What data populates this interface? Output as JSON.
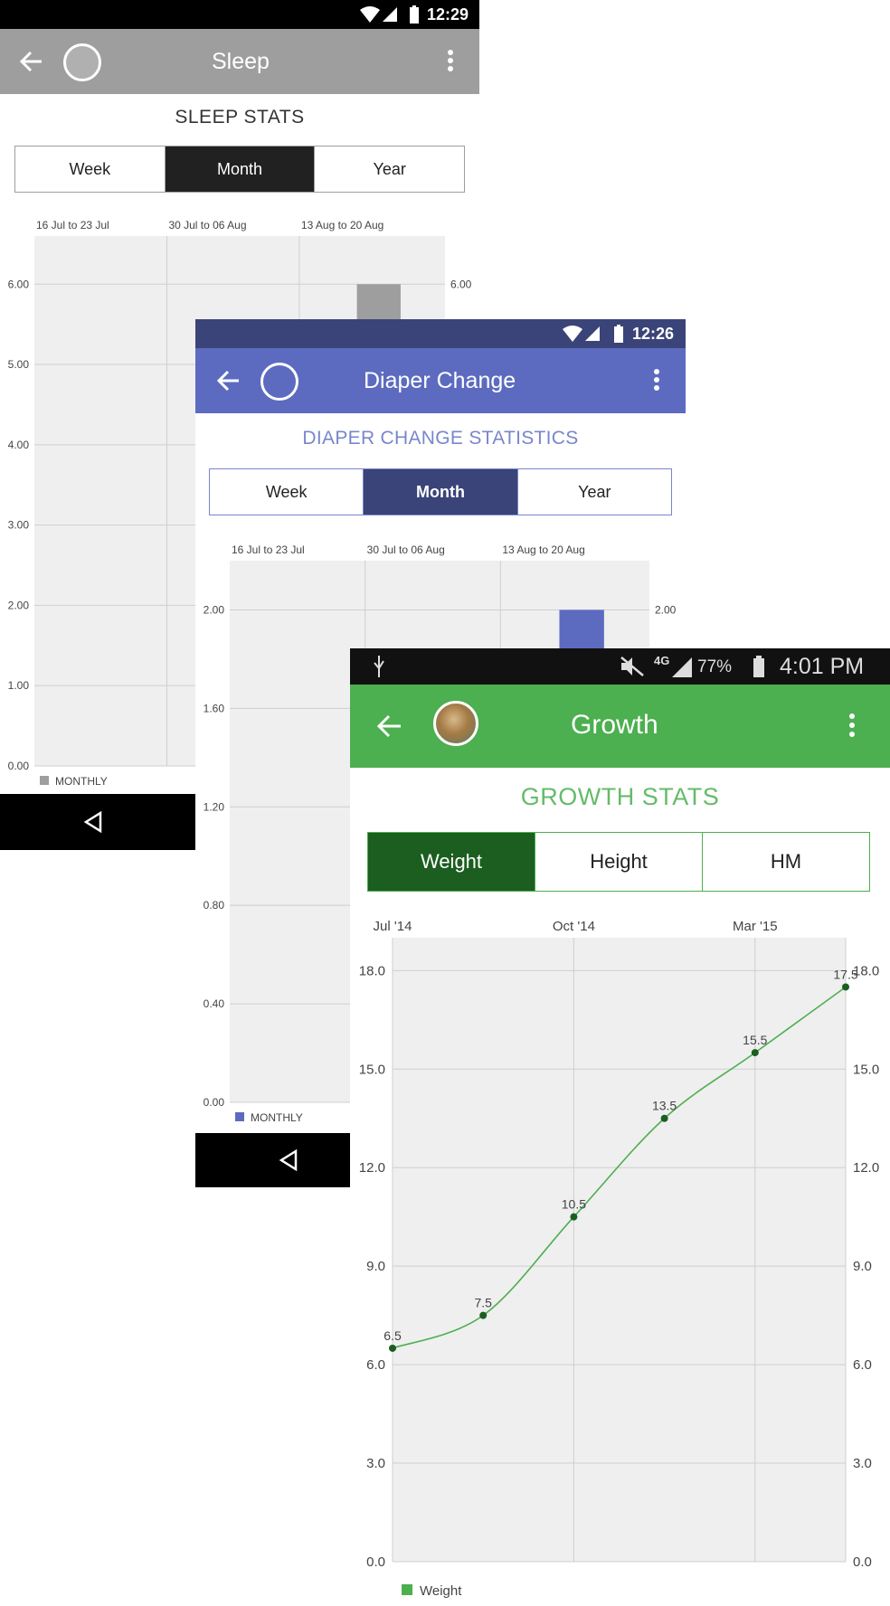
{
  "sleep": {
    "status_time": "12:29",
    "title": "Sleep",
    "heading": "SLEEP STATS",
    "tabs": [
      "Week",
      "Month",
      "Year"
    ],
    "selected_tab": "Month",
    "accent": "#9e9e9e",
    "selected_color": "#212121",
    "chart_data": {
      "type": "bar",
      "categories": [
        "16 Jul to 23 Jul",
        "30 Jul to 06 Aug",
        "13 Aug to 20 Aug"
      ],
      "yticks": [
        "0.00",
        "1.00",
        "2.00",
        "3.00",
        "4.00",
        "5.00",
        "6.00"
      ],
      "ylim": [
        0,
        6.6
      ],
      "right_tick": "6.00",
      "series": [
        {
          "name": "MONTHLY",
          "values": [
            {
              "x": 2.6,
              "y": 6.0
            }
          ],
          "color": "#9e9e9e"
        }
      ]
    }
  },
  "diaper": {
    "status_time": "12:26",
    "title": "Diaper Change",
    "heading": "DIAPER CHANGE STATISTICS",
    "tabs": [
      "Week",
      "Month",
      "Year"
    ],
    "selected_tab": "Month",
    "accent": "#5c6bc0",
    "selected_color": "#3a4478",
    "chart_data": {
      "type": "bar",
      "categories": [
        "16 Jul to 23 Jul",
        "30 Jul to 06 Aug",
        "13 Aug to 20 Aug"
      ],
      "yticks": [
        "0.00",
        "0.40",
        "0.80",
        "1.20",
        "1.60",
        "2.00"
      ],
      "ylim": [
        0,
        2.2
      ],
      "right_tick": "2.00",
      "series": [
        {
          "name": "MONTHLY",
          "values": [
            {
              "x": 2.6,
              "y": 2.0
            }
          ],
          "color": "#5c6bc0"
        }
      ]
    }
  },
  "growth": {
    "status_time": "4:01 PM",
    "battery": "77%",
    "network": "4G",
    "title": "Growth",
    "heading": "GROWTH STATS",
    "tabs": [
      "Weight",
      "Height",
      "HM"
    ],
    "selected_tab": "Weight",
    "accent": "#4caf50",
    "selected_color": "#1b5e20",
    "chart_data": {
      "type": "line",
      "xticks": [
        {
          "label": "Jul '14",
          "x": 0
        },
        {
          "label": "Oct '14",
          "x": 2
        },
        {
          "label": "Mar '15",
          "x": 4
        }
      ],
      "x": [
        0,
        1,
        2,
        3,
        4,
        5
      ],
      "xlim": [
        0,
        5
      ],
      "yticks": [
        "0.0",
        "3.0",
        "6.0",
        "9.0",
        "12.0",
        "15.0",
        "18.0"
      ],
      "ylim": [
        0,
        19
      ],
      "series": [
        {
          "name": "Weight",
          "values": [
            6.5,
            7.5,
            10.5,
            13.5,
            15.5,
            17.5
          ],
          "labels": [
            "6.5",
            "7.5",
            "10.5",
            "13.5",
            "15.5",
            "17.5"
          ],
          "color": "#4caf50",
          "point_color": "#1b5e20"
        }
      ]
    }
  }
}
